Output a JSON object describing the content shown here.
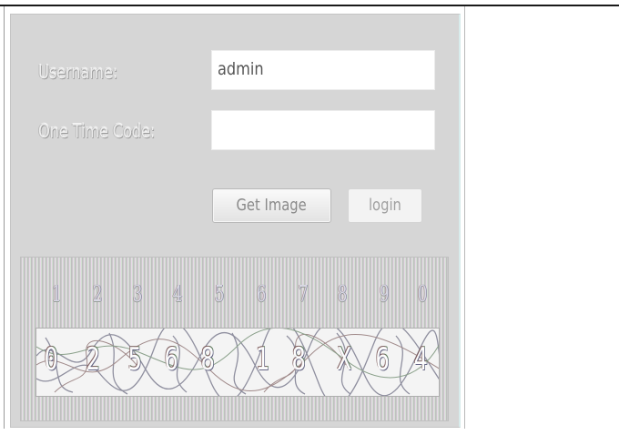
{
  "form": {
    "username_label": "Username:",
    "username_value": "admin",
    "otc_label": "One Time Code:",
    "otc_value": ""
  },
  "buttons": {
    "get_image": "Get Image",
    "login": "login"
  },
  "captcha": {
    "key_digits": [
      "1",
      "2",
      "3",
      "4",
      "5",
      "6",
      "7",
      "8",
      "9",
      "0"
    ],
    "scrambled_glyphs": [
      "0",
      "2",
      "5",
      "6",
      "8",
      "1",
      "8",
      "X",
      "6",
      "4"
    ]
  }
}
